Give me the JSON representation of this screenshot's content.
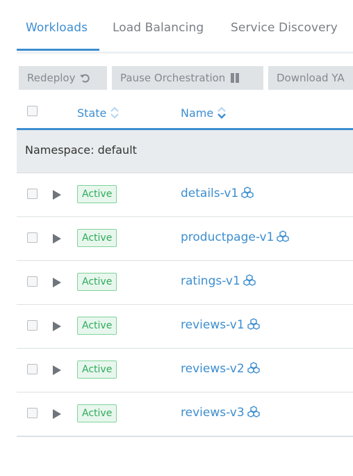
{
  "tabs": [
    {
      "label": "Workloads",
      "active": true
    },
    {
      "label": "Load Balancing",
      "active": false
    },
    {
      "label": "Service Discovery",
      "active": false
    }
  ],
  "toolbar": {
    "redeploy_label": "Redeploy",
    "pause_label": "Pause Orchestration",
    "download_label": "Download YA"
  },
  "table": {
    "columns": {
      "state": "State",
      "name": "Name"
    },
    "namespace_label": "Namespace: default",
    "rows": [
      {
        "state": "Active",
        "name": "details-v1"
      },
      {
        "state": "Active",
        "name": "productpage-v1"
      },
      {
        "state": "Active",
        "name": "ratings-v1"
      },
      {
        "state": "Active",
        "name": "reviews-v1"
      },
      {
        "state": "Active",
        "name": "reviews-v2"
      },
      {
        "state": "Active",
        "name": "reviews-v3"
      }
    ]
  },
  "colors": {
    "accent": "#3d8ed0",
    "active_badge": "#2eaa5c"
  },
  "icons": {
    "redeploy": "undo-icon",
    "pause": "pause-icon",
    "sort": "sort-icon",
    "workload": "workload-cubes-icon"
  }
}
